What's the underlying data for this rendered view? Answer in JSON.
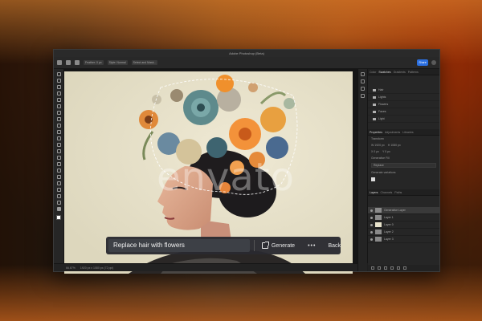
{
  "window": {
    "title": "Adobe Photoshop (Beta)"
  },
  "options_bar": {
    "items": [
      "Feather: 0 px",
      "Style: Normal",
      "Select and Mask..."
    ],
    "share_label": "Share"
  },
  "canvas": {
    "watermark": "envato"
  },
  "contextual_taskbar": {
    "prompt_value": "Replace hair with flowers",
    "generate_label": "Generate",
    "more_label": "•••",
    "back_label": "Back"
  },
  "status_bar": {
    "zoom": "66.67%",
    "doc_info": "1920 px x 1080 px (72 ppi)"
  },
  "panels": {
    "tabs": [
      "Color",
      "Swatches",
      "Gradients",
      "Patterns"
    ],
    "libraries": [
      "Hair",
      "Lights",
      "Flowers",
      "Faces",
      "Light"
    ],
    "properties_tabs": [
      "Properties",
      "Adjustments",
      "Libraries"
    ],
    "properties": {
      "section": "Transform",
      "w": "W 1920 px",
      "h": "H 1080 px",
      "x": "X 0 px",
      "y": "Y 0 px",
      "generative_label": "Generative Fill",
      "select_value": "Replace",
      "checkbox_label": "Generate variations"
    },
    "layers_tabs": [
      "Layers",
      "Channels",
      "Paths"
    ],
    "layers": [
      "Generative Layer",
      "Layer 1",
      "Layer 0",
      "Layer 2",
      "Layer 3"
    ]
  },
  "colors": {
    "accent": "#2b6fe0",
    "canvas_bg": "#e9e5cf",
    "hair": "#1d1b1d"
  }
}
